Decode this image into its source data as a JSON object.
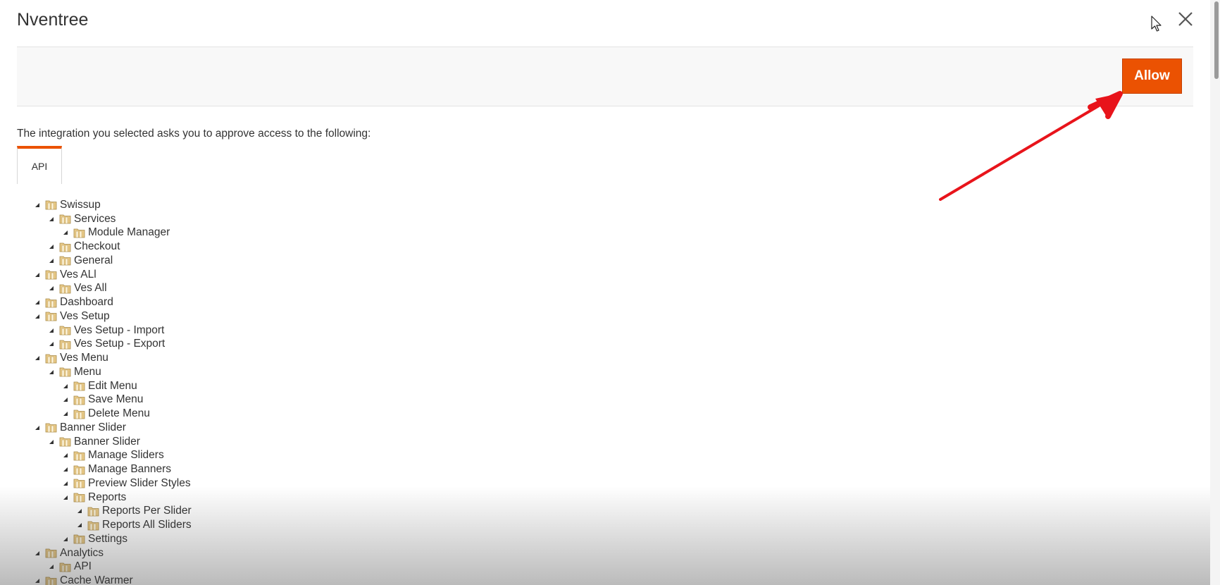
{
  "modal": {
    "title": "Nventree",
    "close_icon": "close-icon"
  },
  "actions": {
    "allow_label": "Allow",
    "allow_color": "#eb5202"
  },
  "intro_text": "The integration you selected asks you to approve access to the following:",
  "tabs": [
    {
      "label": "API",
      "active": true
    }
  ],
  "tree": [
    {
      "label": "Swissup",
      "level": 0
    },
    {
      "label": "Services",
      "level": 1
    },
    {
      "label": "Module Manager",
      "level": 2
    },
    {
      "label": "Checkout",
      "level": 1
    },
    {
      "label": "General",
      "level": 1
    },
    {
      "label": "Ves ALl",
      "level": 0
    },
    {
      "label": "Ves All",
      "level": 1
    },
    {
      "label": "Dashboard",
      "level": 0
    },
    {
      "label": "Ves Setup",
      "level": 0
    },
    {
      "label": "Ves Setup - Import",
      "level": 1
    },
    {
      "label": "Ves Setup - Export",
      "level": 1
    },
    {
      "label": "Ves Menu",
      "level": 0
    },
    {
      "label": "Menu",
      "level": 1
    },
    {
      "label": "Edit Menu",
      "level": 2
    },
    {
      "label": "Save Menu",
      "level": 2
    },
    {
      "label": "Delete Menu",
      "level": 2
    },
    {
      "label": "Banner Slider",
      "level": 0
    },
    {
      "label": "Banner Slider",
      "level": 1
    },
    {
      "label": "Manage Sliders",
      "level": 2
    },
    {
      "label": "Manage Banners",
      "level": 2
    },
    {
      "label": "Preview Slider Styles",
      "level": 2
    },
    {
      "label": "Reports",
      "level": 2
    },
    {
      "label": "Reports Per Slider",
      "level": 3
    },
    {
      "label": "Reports All Sliders",
      "level": 3
    },
    {
      "label": "Settings",
      "level": 2
    },
    {
      "label": "Analytics",
      "level": 0
    },
    {
      "label": "API",
      "level": 1
    },
    {
      "label": "Cache Warmer",
      "level": 0
    }
  ],
  "icons": {
    "tree_folder": "folder-icon",
    "tree_toggle": "expanded-triangle-icon",
    "cursor": "mouse-pointer-icon",
    "annotation": "red-arrow-icon"
  },
  "colors": {
    "accent": "#eb5202",
    "annotation_arrow": "#e8141b",
    "folder_fill": "#e8c987"
  }
}
